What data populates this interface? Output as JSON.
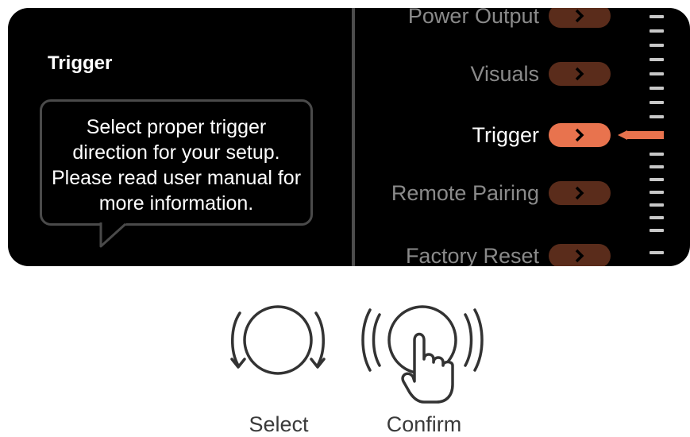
{
  "panel": {
    "title": "Trigger",
    "tooltip": "Select proper trigger direction for your setup. Please read user manual for more information."
  },
  "menu": {
    "items": [
      {
        "label": "Power Output",
        "active": false
      },
      {
        "label": "Visuals",
        "active": false
      },
      {
        "label": "Trigger",
        "active": true
      },
      {
        "label": "Remote Pairing",
        "active": false
      },
      {
        "label": "Factory Reset",
        "active": false
      }
    ]
  },
  "controls": {
    "select_label": "Select",
    "confirm_label": "Confirm"
  },
  "colors": {
    "accent": "#e8734e",
    "accent_dim": "#5a2c1b",
    "screen_bg": "#000000"
  }
}
